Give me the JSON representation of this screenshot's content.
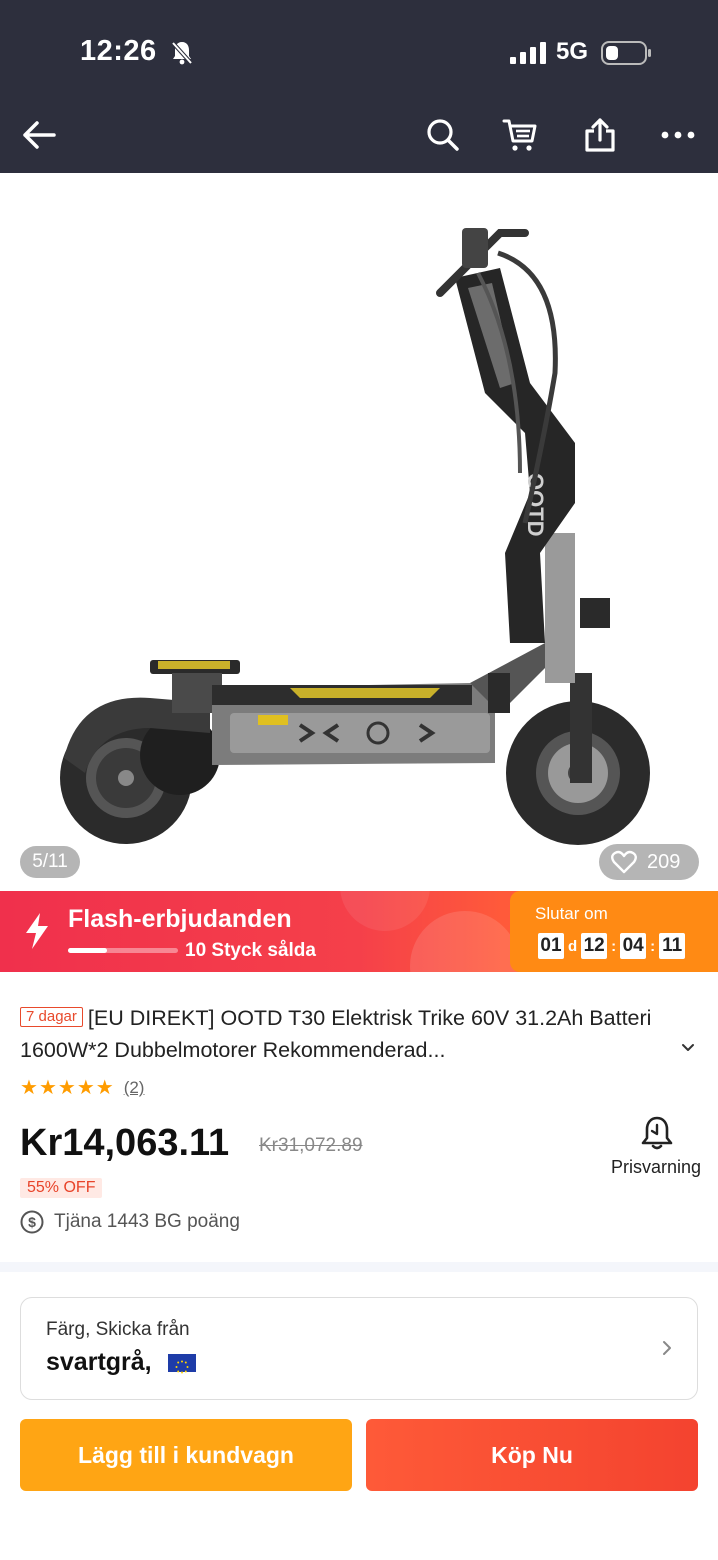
{
  "status_bar": {
    "time": "12:26",
    "network": "5G",
    "icons": [
      "bell-off-icon",
      "signal-icon",
      "battery-icon"
    ]
  },
  "nav": {
    "icons": [
      "back-arrow-icon",
      "search-icon",
      "cart-icon",
      "share-icon",
      "more-icon"
    ]
  },
  "gallery": {
    "counter": "5/11",
    "wishlist_count": "209",
    "product_brand_text": "OOTD"
  },
  "flash_deal": {
    "title": "Flash-erbjudanden",
    "sold_text": "10 Styck sålda",
    "sold_progress": 0.35,
    "ends_label": "Slutar om",
    "days": "01",
    "days_unit": "d",
    "hours": "12",
    "minutes": "04",
    "seconds": "11",
    "separator": ":"
  },
  "product": {
    "delivery_tag": "7 dagar",
    "title": "[EU DIREKT] OOTD T30 Elektrisk Trike 60V 31.2Ah Batteri 1600W*2 Dubbelmotorer Rekommenderad...",
    "rating_stars": 5,
    "review_count": "(2)",
    "price": "Kr14,063.11",
    "original_price": "Kr31,072.89",
    "discount": "55% OFF",
    "points": "Tjäna 1443 BG poäng",
    "price_alert_label": "Prisvarning"
  },
  "options": {
    "label": "Färg, Skicka från",
    "value": "svartgrå,"
  },
  "actions": {
    "add_to_cart": "Lägg till i kundvagn",
    "buy_now": "Köp Nu"
  },
  "colors": {
    "top_bar": "#2d2f3d",
    "flash_red": "#f0304c",
    "timer_orange": "#ff8a14",
    "cart_button": "#ffa514",
    "buy_button": "#f4432f",
    "star": "#ff9c00"
  }
}
